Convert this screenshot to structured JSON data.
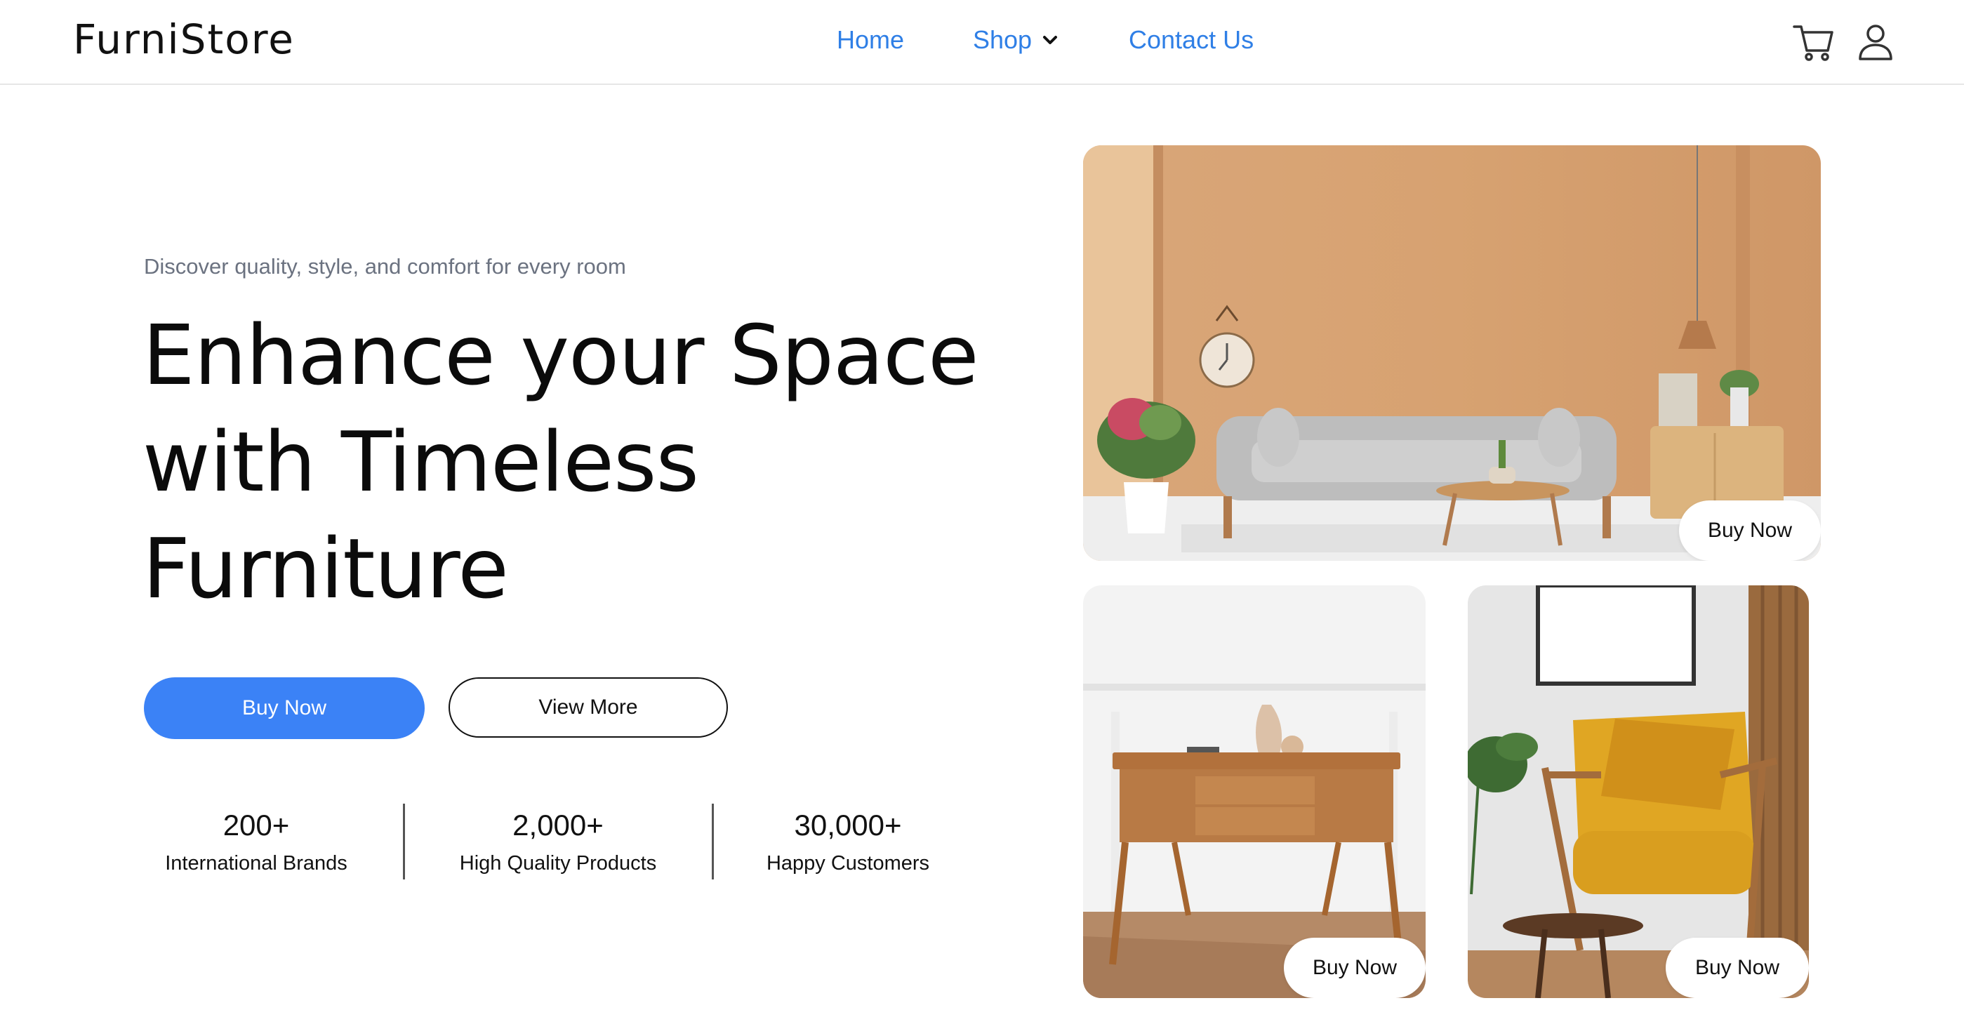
{
  "header": {
    "logo": "FurniStore",
    "nav": {
      "home": "Home",
      "shop": "Shop",
      "contact": "Contact Us"
    },
    "icons": [
      "cart-icon",
      "user-icon",
      "chevron-down-icon"
    ]
  },
  "hero": {
    "subtitle": "Discover quality, style, and comfort for every room",
    "title_line1": "Enhance your Space",
    "title_line2": "with Timeless",
    "title_line3": "Furniture",
    "primary_button": "Buy Now",
    "secondary_button": "View More"
  },
  "stats": [
    {
      "value": "200+",
      "label": "International Brands"
    },
    {
      "value": "2,000+",
      "label": "High Quality Products"
    },
    {
      "value": "30,000+",
      "label": "Happy Customers"
    }
  ],
  "cards": [
    {
      "image": "living-room-sofa-image",
      "button": "Buy Now"
    },
    {
      "image": "wooden-console-table-image",
      "button": "Buy Now"
    },
    {
      "image": "mustard-armchair-image",
      "button": "Buy Now"
    }
  ],
  "colors": {
    "accent": "#3b82f6",
    "nav_link": "#2f7fe6",
    "subtitle": "#6b7280"
  }
}
